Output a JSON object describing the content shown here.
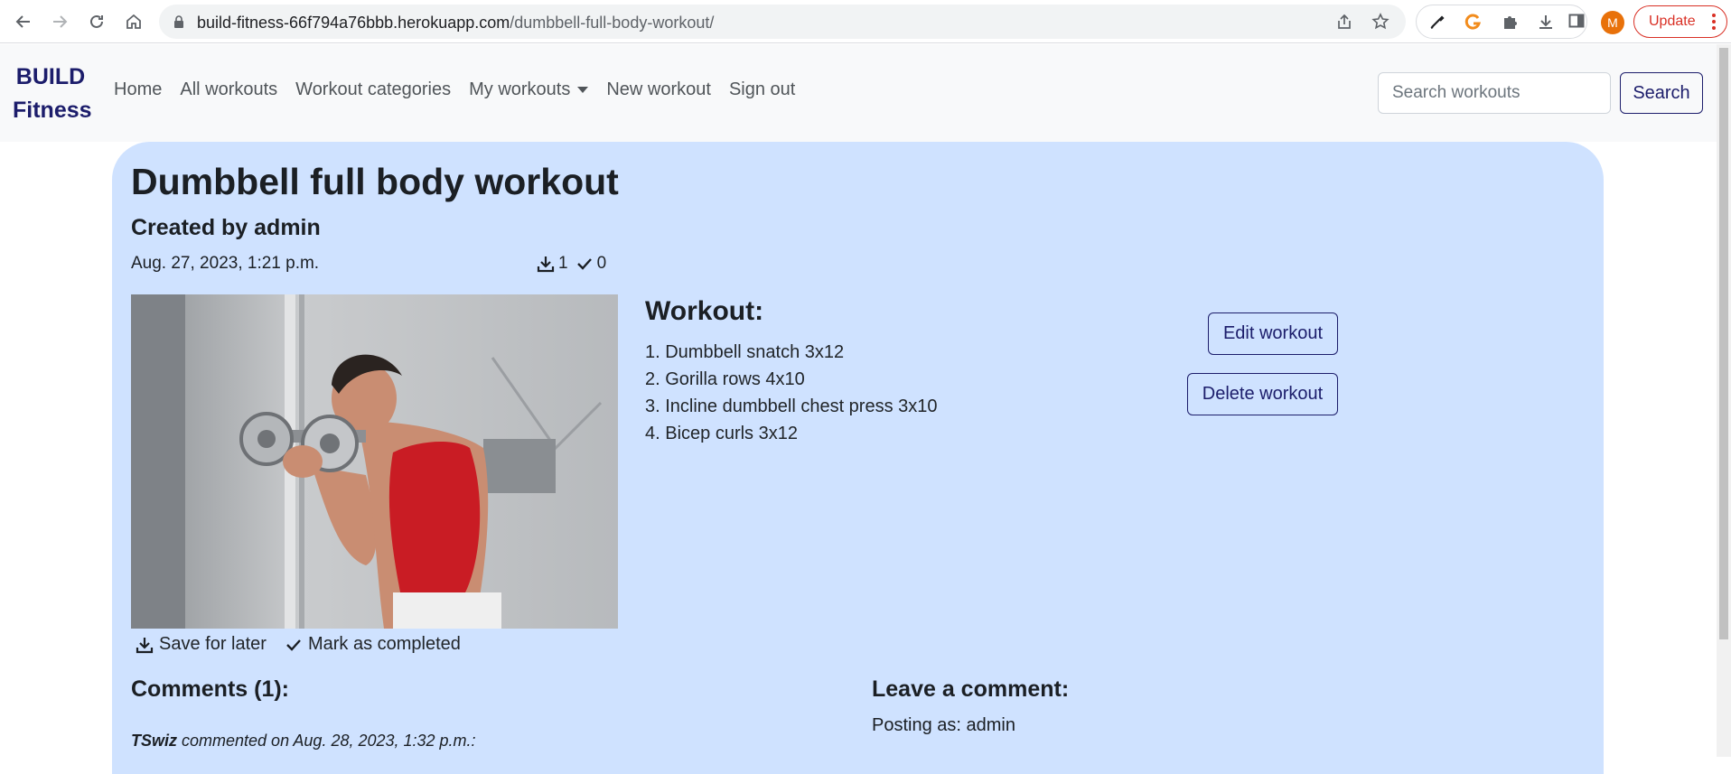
{
  "browser": {
    "url_host": "build-fitness-66f794a76bbb.herokuapp.com",
    "url_path": "/dumbbell-full-body-workout/",
    "avatar_initial": "M",
    "update_label": "Update"
  },
  "navbar": {
    "brand_line1": "BUILD",
    "brand_line2": "Fitness",
    "links": [
      "Home",
      "All workouts",
      "Workout categories",
      "My workouts",
      "New workout",
      "Sign out"
    ],
    "search_placeholder": "Search workouts",
    "search_button": "Search"
  },
  "workout": {
    "title": "Dumbbell full body workout",
    "created_by": "Created by admin",
    "date": "Aug. 27, 2023, 1:21 p.m.",
    "saved_count": "1",
    "completed_count": "0",
    "heading": "Workout:",
    "exercises": [
      "1. Dumbbell snatch 3x12",
      "2. Gorilla rows 4x10",
      "3. Incline dumbbell chest press 3x10",
      "4. Bicep curls 3x12"
    ],
    "edit_label": "Edit workout",
    "delete_label": "Delete workout",
    "save_label": "Save for later",
    "complete_label": "Mark as completed"
  },
  "comments": {
    "heading": "Comments (1):",
    "first_author": "TSwiz",
    "first_meta": " commented on Aug. 28, 2023, 1:32 p.m.:",
    "leave_heading": "Leave a comment:",
    "posting_as": "Posting as: admin"
  }
}
